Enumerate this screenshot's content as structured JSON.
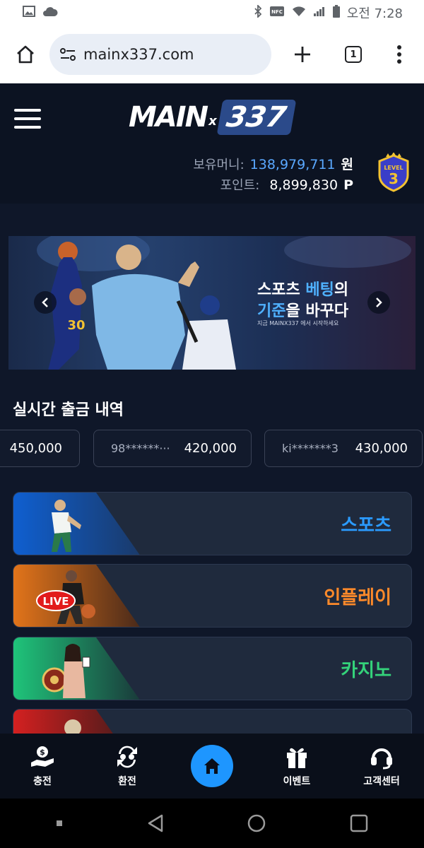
{
  "status_bar": {
    "time": "오전 7:28"
  },
  "browser": {
    "url": "mainx337.com",
    "tab_count": "1"
  },
  "site": {
    "logo_main": "MAIN",
    "logo_x": "x",
    "logo_num": "337",
    "wallet": {
      "money_label": "보유머니:",
      "money_value": "138,979,711",
      "money_unit": "원",
      "point_label": "포인트:",
      "point_value": "8,899,830",
      "point_unit": "P"
    },
    "level_badge": {
      "text": "LEVEL",
      "number": "3"
    }
  },
  "banner": {
    "headline_1a": "스포츠 ",
    "headline_1b": "베팅",
    "headline_1c": "의",
    "headline_2a": "기준",
    "headline_2b": "을 바꾸다",
    "subtext": "지금 MAINX337 에서 시작하세요",
    "player_number": "30"
  },
  "withdrawals": {
    "title": "실시간 출금 내역",
    "items": [
      {
        "user": "",
        "amount": "450,000"
      },
      {
        "user": "98******···",
        "amount": "420,000"
      },
      {
        "user": "ki*******3",
        "amount": "430,000"
      }
    ]
  },
  "categories": [
    {
      "label": "스포츠",
      "color": "#2b9bff",
      "stripe": "#1670d8"
    },
    {
      "label": "인플레이",
      "color": "#ff8a2a",
      "stripe": "#e26a12",
      "badge": "LIVE"
    },
    {
      "label": "카지노",
      "color": "#34d27a",
      "stripe": "#1fae64"
    },
    {
      "label": "",
      "color": "#ff4040",
      "stripe": "#c81e1e"
    }
  ],
  "bottom_nav": {
    "charge": "충전",
    "exchange": "환전",
    "event": "이벤트",
    "support": "고객센터"
  }
}
